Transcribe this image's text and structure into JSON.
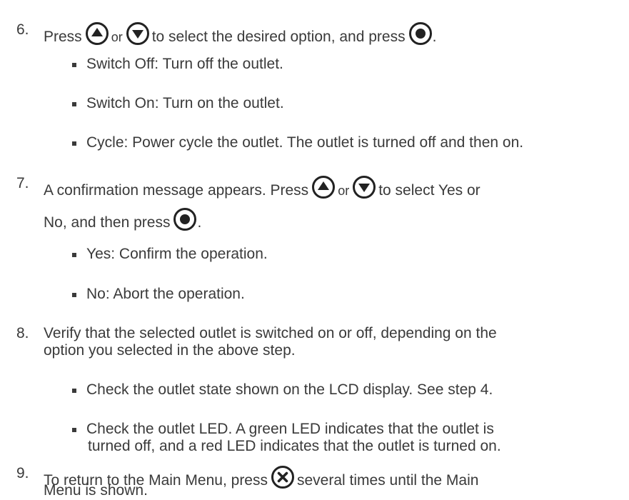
{
  "steps": [
    {
      "number": "6.",
      "line1": {
        "press": "Press",
        "or": "or",
        "rest": "to select the desired option, and press",
        "end": "."
      },
      "bullets": [
        "Switch Off: Turn off the outlet.",
        "Switch On: Turn on the outlet.",
        "Cycle: Power cycle the outlet. The outlet is turned off and then on."
      ]
    },
    {
      "number": "7.",
      "line1": {
        "start": "A confirmation message appears. Press",
        "or": "or",
        "rest": "to select Yes or"
      },
      "line2": {
        "start": "No, and then press",
        "end": "."
      },
      "bullets": [
        "Yes: Confirm the operation.",
        "No: Abort the operation."
      ]
    },
    {
      "number": "8.",
      "line1": "Verify that the selected outlet is switched on or off, depending on the",
      "line2": "option you selected in the above step.",
      "bullets": [
        "Check the outlet state shown on the LCD display. See step 4."
      ],
      "bullet2": {
        "line1": "Check the outlet LED. A green LED indicates that the outlet is",
        "line2": "turned off, and a red LED indicates that the outlet is turned on."
      }
    },
    {
      "number": "9.",
      "line1": {
        "start": "To return to the Main Menu, press",
        "rest": "several times until the Main"
      },
      "line2": "Menu is shown."
    }
  ],
  "icons": {
    "up": "up-arrow-button-icon",
    "down": "down-arrow-button-icon",
    "select": "select-dot-button-icon",
    "close": "close-x-button-icon"
  }
}
